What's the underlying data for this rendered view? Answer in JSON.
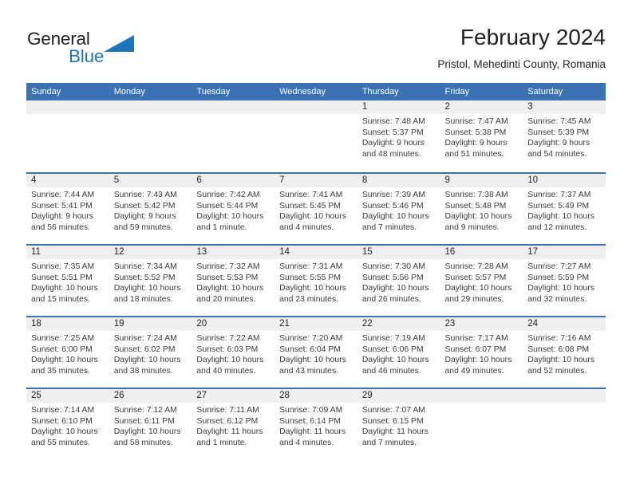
{
  "brand": {
    "name_part1": "General",
    "name_part2": "Blue",
    "logo_color": "#1a75bb"
  },
  "header": {
    "title": "February 2024",
    "location": "Pristol, Mehedinti County, Romania"
  },
  "theme": {
    "header_blue": "#3a72b4",
    "daynum_band": "#efefef",
    "text": "#231f20"
  },
  "weekdays": [
    "Sunday",
    "Monday",
    "Tuesday",
    "Wednesday",
    "Thursday",
    "Friday",
    "Saturday"
  ],
  "weeks": [
    [
      {
        "day": "",
        "lines": []
      },
      {
        "day": "",
        "lines": []
      },
      {
        "day": "",
        "lines": []
      },
      {
        "day": "",
        "lines": []
      },
      {
        "day": "1",
        "lines": [
          "Sunrise: 7:48 AM",
          "Sunset: 5:37 PM",
          "Daylight: 9 hours",
          "and 48 minutes."
        ]
      },
      {
        "day": "2",
        "lines": [
          "Sunrise: 7:47 AM",
          "Sunset: 5:38 PM",
          "Daylight: 9 hours",
          "and 51 minutes."
        ]
      },
      {
        "day": "3",
        "lines": [
          "Sunrise: 7:45 AM",
          "Sunset: 5:39 PM",
          "Daylight: 9 hours",
          "and 54 minutes."
        ]
      }
    ],
    [
      {
        "day": "4",
        "lines": [
          "Sunrise: 7:44 AM",
          "Sunset: 5:41 PM",
          "Daylight: 9 hours",
          "and 56 minutes."
        ]
      },
      {
        "day": "5",
        "lines": [
          "Sunrise: 7:43 AM",
          "Sunset: 5:42 PM",
          "Daylight: 9 hours",
          "and 59 minutes."
        ]
      },
      {
        "day": "6",
        "lines": [
          "Sunrise: 7:42 AM",
          "Sunset: 5:44 PM",
          "Daylight: 10 hours",
          "and 1 minute."
        ]
      },
      {
        "day": "7",
        "lines": [
          "Sunrise: 7:41 AM",
          "Sunset: 5:45 PM",
          "Daylight: 10 hours",
          "and 4 minutes."
        ]
      },
      {
        "day": "8",
        "lines": [
          "Sunrise: 7:39 AM",
          "Sunset: 5:46 PM",
          "Daylight: 10 hours",
          "and 7 minutes."
        ]
      },
      {
        "day": "9",
        "lines": [
          "Sunrise: 7:38 AM",
          "Sunset: 5:48 PM",
          "Daylight: 10 hours",
          "and 9 minutes."
        ]
      },
      {
        "day": "10",
        "lines": [
          "Sunrise: 7:37 AM",
          "Sunset: 5:49 PM",
          "Daylight: 10 hours",
          "and 12 minutes."
        ]
      }
    ],
    [
      {
        "day": "11",
        "lines": [
          "Sunrise: 7:35 AM",
          "Sunset: 5:51 PM",
          "Daylight: 10 hours",
          "and 15 minutes."
        ]
      },
      {
        "day": "12",
        "lines": [
          "Sunrise: 7:34 AM",
          "Sunset: 5:52 PM",
          "Daylight: 10 hours",
          "and 18 minutes."
        ]
      },
      {
        "day": "13",
        "lines": [
          "Sunrise: 7:32 AM",
          "Sunset: 5:53 PM",
          "Daylight: 10 hours",
          "and 20 minutes."
        ]
      },
      {
        "day": "14",
        "lines": [
          "Sunrise: 7:31 AM",
          "Sunset: 5:55 PM",
          "Daylight: 10 hours",
          "and 23 minutes."
        ]
      },
      {
        "day": "15",
        "lines": [
          "Sunrise: 7:30 AM",
          "Sunset: 5:56 PM",
          "Daylight: 10 hours",
          "and 26 minutes."
        ]
      },
      {
        "day": "16",
        "lines": [
          "Sunrise: 7:28 AM",
          "Sunset: 5:57 PM",
          "Daylight: 10 hours",
          "and 29 minutes."
        ]
      },
      {
        "day": "17",
        "lines": [
          "Sunrise: 7:27 AM",
          "Sunset: 5:59 PM",
          "Daylight: 10 hours",
          "and 32 minutes."
        ]
      }
    ],
    [
      {
        "day": "18",
        "lines": [
          "Sunrise: 7:25 AM",
          "Sunset: 6:00 PM",
          "Daylight: 10 hours",
          "and 35 minutes."
        ]
      },
      {
        "day": "19",
        "lines": [
          "Sunrise: 7:24 AM",
          "Sunset: 6:02 PM",
          "Daylight: 10 hours",
          "and 38 minutes."
        ]
      },
      {
        "day": "20",
        "lines": [
          "Sunrise: 7:22 AM",
          "Sunset: 6:03 PM",
          "Daylight: 10 hours",
          "and 40 minutes."
        ]
      },
      {
        "day": "21",
        "lines": [
          "Sunrise: 7:20 AM",
          "Sunset: 6:04 PM",
          "Daylight: 10 hours",
          "and 43 minutes."
        ]
      },
      {
        "day": "22",
        "lines": [
          "Sunrise: 7:19 AM",
          "Sunset: 6:06 PM",
          "Daylight: 10 hours",
          "and 46 minutes."
        ]
      },
      {
        "day": "23",
        "lines": [
          "Sunrise: 7:17 AM",
          "Sunset: 6:07 PM",
          "Daylight: 10 hours",
          "and 49 minutes."
        ]
      },
      {
        "day": "24",
        "lines": [
          "Sunrise: 7:16 AM",
          "Sunset: 6:08 PM",
          "Daylight: 10 hours",
          "and 52 minutes."
        ]
      }
    ],
    [
      {
        "day": "25",
        "lines": [
          "Sunrise: 7:14 AM",
          "Sunset: 6:10 PM",
          "Daylight: 10 hours",
          "and 55 minutes."
        ]
      },
      {
        "day": "26",
        "lines": [
          "Sunrise: 7:12 AM",
          "Sunset: 6:11 PM",
          "Daylight: 10 hours",
          "and 58 minutes."
        ]
      },
      {
        "day": "27",
        "lines": [
          "Sunrise: 7:11 AM",
          "Sunset: 6:12 PM",
          "Daylight: 11 hours",
          "and 1 minute."
        ]
      },
      {
        "day": "28",
        "lines": [
          "Sunrise: 7:09 AM",
          "Sunset: 6:14 PM",
          "Daylight: 11 hours",
          "and 4 minutes."
        ]
      },
      {
        "day": "29",
        "lines": [
          "Sunrise: 7:07 AM",
          "Sunset: 6:15 PM",
          "Daylight: 11 hours",
          "and 7 minutes."
        ]
      },
      {
        "day": "",
        "lines": []
      },
      {
        "day": "",
        "lines": []
      }
    ]
  ]
}
